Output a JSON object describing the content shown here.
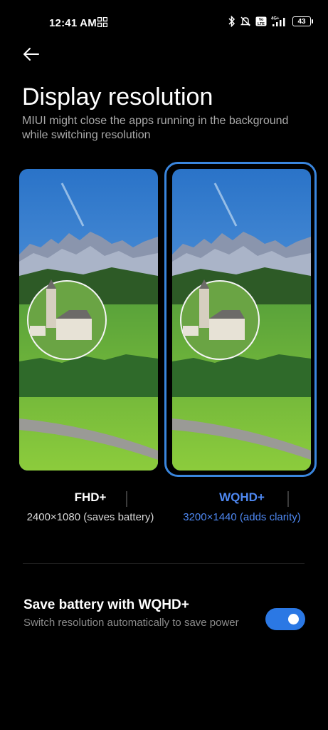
{
  "status_bar": {
    "time": "12:41 AM",
    "network_label": "4G+",
    "volte_label": "Vo LTE",
    "battery": "43",
    "icons": [
      "grid-icon",
      "bluetooth-icon",
      "mute-icon",
      "volte-icon",
      "signal-icon",
      "battery-icon"
    ]
  },
  "header": {
    "back_icon": "arrow-left-icon"
  },
  "page": {
    "title": "Display resolution",
    "subtitle": "MIUI might close the apps running in the background while switching resolution"
  },
  "options": [
    {
      "name": "FHD+",
      "desc": "2400×1080 (saves battery)",
      "selected": false
    },
    {
      "name": "WQHD+",
      "desc": "3200×1440 (adds clarity)",
      "selected": true
    }
  ],
  "setting": {
    "title": "Save battery with WQHD+",
    "description": "Switch resolution automatically to save power",
    "enabled": true
  },
  "colors": {
    "accent": "#2b78e4",
    "background": "#000000",
    "selected_text": "#4e88f2"
  }
}
